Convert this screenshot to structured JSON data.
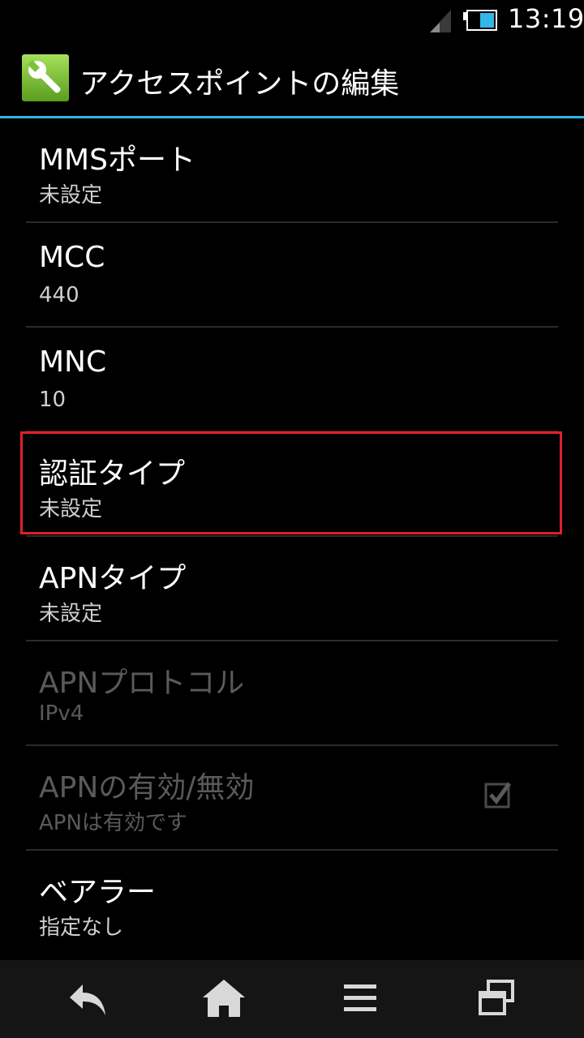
{
  "status_bar": {
    "time": "13:19"
  },
  "action_bar": {
    "title": "アクセスポイントの編集"
  },
  "settings": [
    {
      "title": "MMSポート",
      "summary": "未設定",
      "enabled": true
    },
    {
      "title": "MCC",
      "summary": "440",
      "enabled": true
    },
    {
      "title": "MNC",
      "summary": "10",
      "enabled": true
    },
    {
      "title": "認証タイプ",
      "summary": "未設定",
      "enabled": true,
      "highlighted": true
    },
    {
      "title": "APNタイプ",
      "summary": "未設定",
      "enabled": true
    },
    {
      "title": "APNプロトコル",
      "summary": "IPv4",
      "enabled": false
    },
    {
      "title": "APNの有効/無効",
      "summary": "APNは有効です",
      "enabled": false,
      "checked": true
    },
    {
      "title": "ベアラー",
      "summary": "指定なし",
      "enabled": true
    }
  ],
  "colors": {
    "accent": "#33b5e5",
    "highlight": "#e0202a"
  },
  "icons": {
    "app": "wrench-icon",
    "nav": [
      "back-icon",
      "home-icon",
      "menu-icon",
      "recent-apps-icon"
    ]
  }
}
